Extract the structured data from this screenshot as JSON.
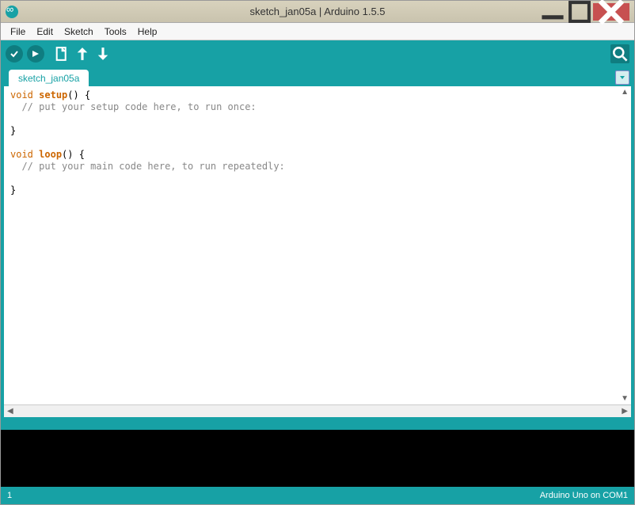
{
  "titlebar": {
    "title": "sketch_jan05a | Arduino 1.5.5"
  },
  "menu": {
    "file": "File",
    "edit": "Edit",
    "sketch": "Sketch",
    "tools": "Tools",
    "help": "Help"
  },
  "tab": {
    "name": "sketch_jan05a"
  },
  "code": {
    "l1_kw": "void",
    "l1_fn": "setup",
    "l1_rest": "() {",
    "l2_cm": "  // put your setup code here, to run once:",
    "l3_blank": "",
    "l4": "}",
    "l5_blank": "",
    "l6_kw": "void",
    "l6_fn": "loop",
    "l6_rest": "() {",
    "l7_cm": "  // put your main code here, to run repeatedly:",
    "l8_blank": "",
    "l9": "}"
  },
  "status": {
    "line": "1",
    "board": "Arduino Uno on COM1"
  }
}
